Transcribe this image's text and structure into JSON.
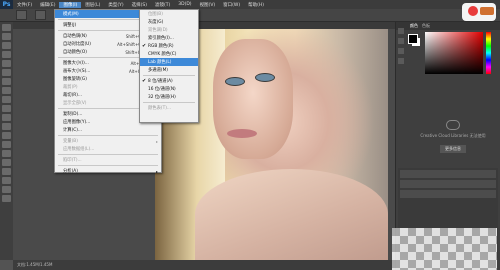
{
  "app": {
    "logo": "Ps"
  },
  "menubar": {
    "items": [
      "文件(F)",
      "编辑(E)",
      "图像(I)",
      "图层(L)",
      "类型(Y)",
      "选择(S)",
      "滤镜(T)",
      "3D(D)",
      "视图(V)",
      "窗口(W)",
      "帮助(H)"
    ],
    "active_index": 2
  },
  "options": {
    "label": ""
  },
  "document": {
    "tab": ""
  },
  "status": {
    "text": "文档:1.45M/1.45M"
  },
  "image_menu": {
    "items": [
      {
        "label": "模式(M)",
        "arrow": "▸",
        "highlight": true
      },
      {
        "sep": true
      },
      {
        "label": "调整(J)",
        "arrow": "▸"
      },
      {
        "sep": true
      },
      {
        "label": "自动色调(N)",
        "shortcut": "Shift+Ctrl+L"
      },
      {
        "label": "自动对比度(U)",
        "shortcut": "Alt+Shift+Ctrl+L"
      },
      {
        "label": "自动颜色(O)",
        "shortcut": "Shift+Ctrl+B"
      },
      {
        "sep": true
      },
      {
        "label": "图像大小(I)...",
        "shortcut": "Alt+Ctrl+I"
      },
      {
        "label": "画布大小(S)...",
        "shortcut": "Alt+Ctrl+C"
      },
      {
        "label": "图像旋转(G)",
        "arrow": "▸"
      },
      {
        "label": "裁剪(P)",
        "disabled": true
      },
      {
        "label": "裁切(R)..."
      },
      {
        "label": "显示全部(V)",
        "disabled": true
      },
      {
        "sep": true
      },
      {
        "label": "复制(D)..."
      },
      {
        "label": "应用图像(Y)..."
      },
      {
        "label": "计算(C)..."
      },
      {
        "sep": true
      },
      {
        "label": "变量(B)",
        "arrow": "▸",
        "disabled": true
      },
      {
        "label": "应用数据组(L)...",
        "disabled": true
      },
      {
        "sep": true
      },
      {
        "label": "陷印(T)...",
        "disabled": true
      },
      {
        "sep": true
      },
      {
        "label": "分析(A)",
        "arrow": "▸"
      }
    ]
  },
  "mode_menu": {
    "items": [
      {
        "label": "位图(B)",
        "disabled": true
      },
      {
        "label": "灰度(G)"
      },
      {
        "label": "双色调(D)",
        "disabled": true
      },
      {
        "label": "索引颜色(I)..."
      },
      {
        "label": "RGB 颜色(R)",
        "check": "✔"
      },
      {
        "label": "CMYK 颜色(C)"
      },
      {
        "label": "Lab 颜色(L)",
        "highlight": true
      },
      {
        "label": "多通道(M)"
      },
      {
        "sep": true
      },
      {
        "label": "8 位/通道(A)",
        "check": "✔"
      },
      {
        "label": "16 位/通道(N)"
      },
      {
        "label": "32 位/通道(H)"
      },
      {
        "sep": true
      },
      {
        "label": "颜色表(T)...",
        "disabled": true
      }
    ]
  },
  "right_panel": {
    "tabs": [
      "颜色",
      "色板"
    ],
    "cc_text": "Creative Cloud Libraries 无法使用",
    "cc_button": "更多信息"
  },
  "colors": {
    "accent": "#3d89d8",
    "menubar": "#3c3c3c"
  }
}
